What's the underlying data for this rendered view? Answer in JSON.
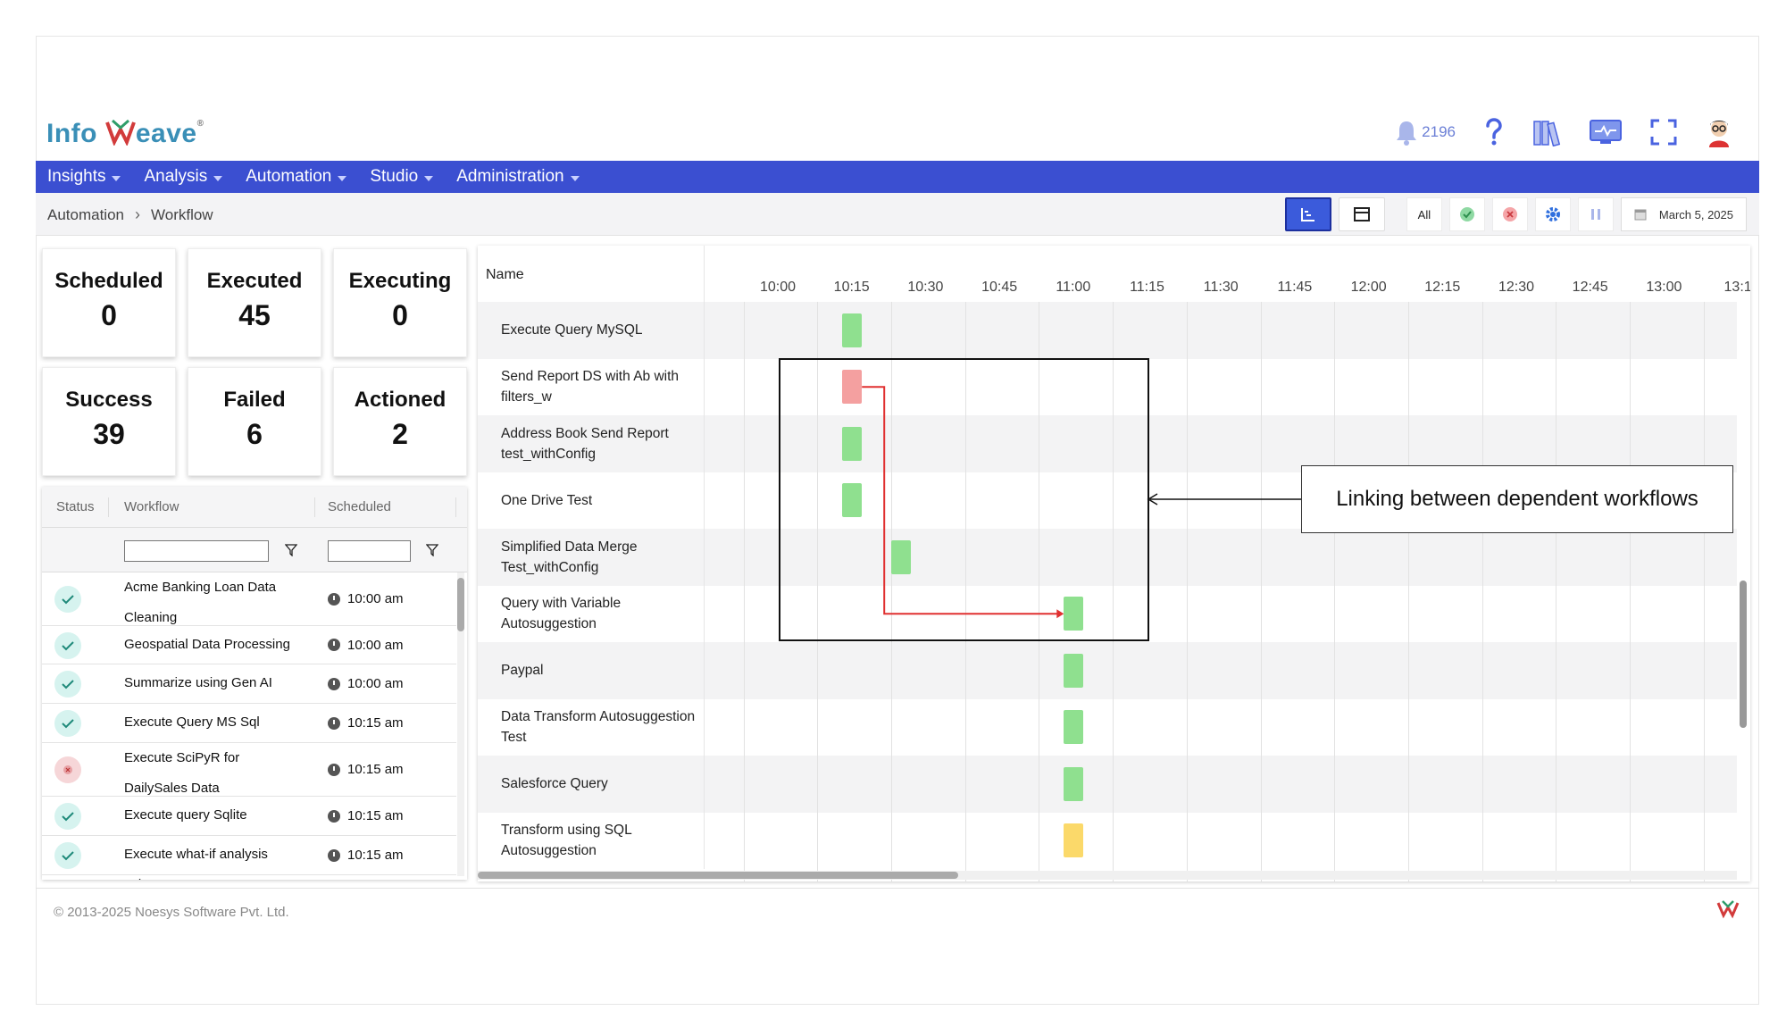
{
  "brand": {
    "logo_text_a": "Info",
    "logo_text_b": "eave",
    "logo_reg": "®"
  },
  "header": {
    "notification_count": "2196"
  },
  "nav": {
    "items": [
      "Insights",
      "Analysis",
      "Automation",
      "Studio",
      "Administration"
    ]
  },
  "breadcrumb": {
    "items": [
      "Automation",
      "Workflow"
    ]
  },
  "toolbar": {
    "all_label": "All",
    "date": "March 5, 2025"
  },
  "stats": [
    {
      "label": "Scheduled",
      "value": "0"
    },
    {
      "label": "Executed",
      "value": "45"
    },
    {
      "label": "Executing",
      "value": "0"
    },
    {
      "label": "Success",
      "value": "39"
    },
    {
      "label": "Failed",
      "value": "6"
    },
    {
      "label": "Actioned",
      "value": "2"
    }
  ],
  "workflow_table": {
    "columns": [
      "Status",
      "Workflow",
      "Scheduled"
    ],
    "rows": [
      {
        "status": "success",
        "name": "Acme Banking Loan Data Cleaning",
        "time": "10:00 am"
      },
      {
        "status": "success",
        "name": "Geospatial Data Processing",
        "time": "10:00 am"
      },
      {
        "status": "success",
        "name": "Summarize using Gen AI",
        "time": "10:00 am"
      },
      {
        "status": "success",
        "name": "Execute Query MS Sql",
        "time": "10:15 am"
      },
      {
        "status": "failed",
        "name": "Execute SciPyR for DailySales Data",
        "time": "10:15 am"
      },
      {
        "status": "success",
        "name": "Execute query Sqlite",
        "time": "10:15 am"
      },
      {
        "status": "success",
        "name": "Execute what-if analysis sales",
        "time": "10:15 am"
      }
    ]
  },
  "gantt": {
    "name_header": "Name",
    "ticks": [
      "10:00",
      "10:15",
      "10:30",
      "10:45",
      "11:00",
      "11:15",
      "11:30",
      "11:45",
      "12:00",
      "12:15",
      "12:30",
      "12:45",
      "13:00",
      "13:1"
    ],
    "colors": {
      "success": "#8fe08f",
      "failed": "#f4a0a0",
      "warning": "#fbd96a",
      "link": "#e03030"
    },
    "rows": [
      {
        "name": "Execute Query MySQL",
        "start": "10:15",
        "status": "success"
      },
      {
        "name": "Send Report DS with Ab with filters_w",
        "start": "10:15",
        "status": "failed"
      },
      {
        "name": "Address Book Send Report test_withConfig",
        "start": "10:15",
        "status": "success"
      },
      {
        "name": "One Drive Test",
        "start": "10:15",
        "status": "success"
      },
      {
        "name": "Simplified Data Merge Test_withConfig",
        "start": "10:25",
        "status": "success"
      },
      {
        "name": "Query with Variable Autosuggestion",
        "start": "11:00",
        "status": "success"
      },
      {
        "name": "Paypal",
        "start": "11:00",
        "status": "success"
      },
      {
        "name": "Data Transform Autosuggestion Test",
        "start": "11:00",
        "status": "success"
      },
      {
        "name": "Salesforce Query",
        "start": "11:00",
        "status": "success"
      },
      {
        "name": "Transform using SQL Autosuggestion",
        "start": "11:00",
        "status": "warning"
      }
    ],
    "callout": "Linking between dependent workflows"
  },
  "footer": {
    "copyright": "© 2013-2025 Noesys Software Pvt. Ltd."
  }
}
